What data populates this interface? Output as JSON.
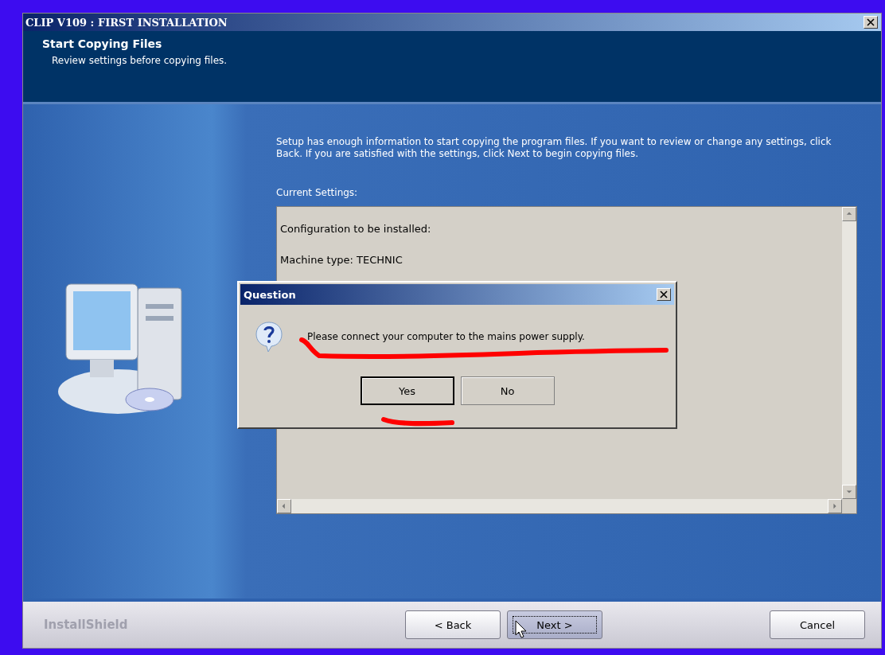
{
  "window": {
    "title": "CLIP V109 : FIRST INSTALLATION"
  },
  "header": {
    "title": "Start Copying Files",
    "subtitle": "Review settings before copying files."
  },
  "content": {
    "intro": "Setup has enough information to start copying the program files.  If you want to review or change any settings, click Back.  If you are satisfied with the settings, click Next to begin copying files.",
    "settings_label": "Current Settings:",
    "settings_lines": [
      "Configuration to be installed:",
      "Machine type: TECHNIC"
    ]
  },
  "dialog": {
    "title": "Question",
    "message": "Please connect your computer to the mains power supply.",
    "buttons": [
      {
        "label": "Yes",
        "default": true
      },
      {
        "label": "No",
        "default": false
      }
    ]
  },
  "footer": {
    "brand": "InstallShield",
    "buttons": [
      {
        "label": "< Back",
        "focused": false
      },
      {
        "label": "Next >",
        "focused": true
      },
      {
        "label": "Cancel",
        "focused": false
      }
    ]
  }
}
